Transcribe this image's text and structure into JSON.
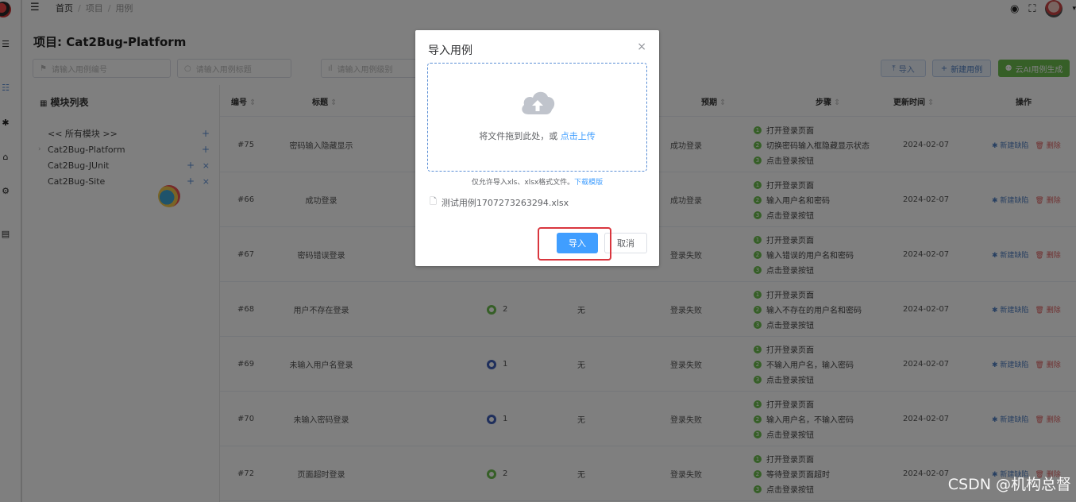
{
  "rail": {
    "icons": [
      "app-logo",
      "list-icon",
      "case-icon",
      "defect-icon",
      "report-icon",
      "settings-icon",
      "doc-icon"
    ]
  },
  "topbar": {
    "menu_icon": "indent-icon",
    "breadcrumb": [
      "首页",
      "项目",
      "用例"
    ],
    "right_icons": [
      "github-icon",
      "fullscreen-icon",
      "avatar",
      "chevron-down-icon"
    ]
  },
  "project": {
    "title": "项目: Cat2Bug-Platform"
  },
  "filters": {
    "case_no_placeholder": "请输入用例编号",
    "title_placeholder": "请输入用例标题",
    "level_placeholder": "请输入用例级别"
  },
  "toolbar": {
    "import_label": "导入",
    "new_label": "新建用例",
    "ai_label": "云AI用例生成"
  },
  "modules": {
    "header": "模块列表",
    "items": [
      {
        "name": "<< 所有模块 >>",
        "actions": [
          "add"
        ]
      },
      {
        "name": "Cat2Bug-Platform",
        "actions": [
          "add"
        ]
      },
      {
        "name": "Cat2Bug-JUnit",
        "actions": [
          "add",
          "delete"
        ]
      },
      {
        "name": "Cat2Bug-Site",
        "actions": [
          "add",
          "delete"
        ]
      }
    ]
  },
  "table": {
    "headers": [
      "编号",
      "标题",
      "预期",
      "步骤",
      "更新时间",
      "操作"
    ],
    "rows": [
      {
        "id": "#75",
        "title": "密码输入隐藏显示",
        "level": "",
        "pre": "",
        "expect": "成功登录",
        "steps": [
          "打开登录页面",
          "切换密码输入框隐藏显示状态",
          "点击登录按钮"
        ],
        "date": "2024-02-07"
      },
      {
        "id": "#66",
        "title": "成功登录",
        "level": "",
        "pre": "",
        "expect": "成功登录",
        "steps": [
          "打开登录页面",
          "输入用户名和密码",
          "点击登录按钮"
        ],
        "date": "2024-02-07"
      },
      {
        "id": "#67",
        "title": "密码错误登录",
        "level": "",
        "pre": "",
        "expect": "登录失败",
        "steps": [
          "打开登录页面",
          "输入错误的用户名和密码",
          "点击登录按钮"
        ],
        "date": "2024-02-07"
      },
      {
        "id": "#68",
        "title": "用户不存在登录",
        "level": "2",
        "pre": "无",
        "expect": "登录失败",
        "steps": [
          "打开登录页面",
          "输入不存在的用户名和密码",
          "点击登录按钮"
        ],
        "date": "2024-02-07"
      },
      {
        "id": "#69",
        "title": "未输入用户名登录",
        "level": "1",
        "pre": "无",
        "expect": "登录失败",
        "steps": [
          "打开登录页面",
          "不输入用户名，输入密码",
          "点击登录按钮"
        ],
        "date": "2024-02-07"
      },
      {
        "id": "#70",
        "title": "未输入密码登录",
        "level": "1",
        "pre": "无",
        "expect": "登录失败",
        "steps": [
          "打开登录页面",
          "输入用户名，不输入密码",
          "点击登录按钮"
        ],
        "date": "2024-02-07"
      },
      {
        "id": "#72",
        "title": "页面超时登录",
        "level": "2",
        "pre": "无",
        "expect": "登录失败",
        "steps": [
          "打开登录页面",
          "等待登录页面超时",
          "点击登录按钮"
        ],
        "date": "2024-02-07"
      }
    ],
    "op_new_defect": "新建缺陷",
    "op_delete": "删除"
  },
  "dialog": {
    "title": "导入用例",
    "drop_text": "将文件拖到此处，或 ",
    "drop_link": "点击上传",
    "tip_text": "仅允许导入xls、xlsx格式文件。",
    "tip_link": "下载模版",
    "file_name": "测试用例1707273263294.xlsx",
    "ok_label": "导入",
    "cancel_label": "取消"
  },
  "watermark": "CSDN @机构总督",
  "colors": {
    "primary": "#409eff",
    "success": "#6cbf4f",
    "danger": "#d9363e"
  }
}
